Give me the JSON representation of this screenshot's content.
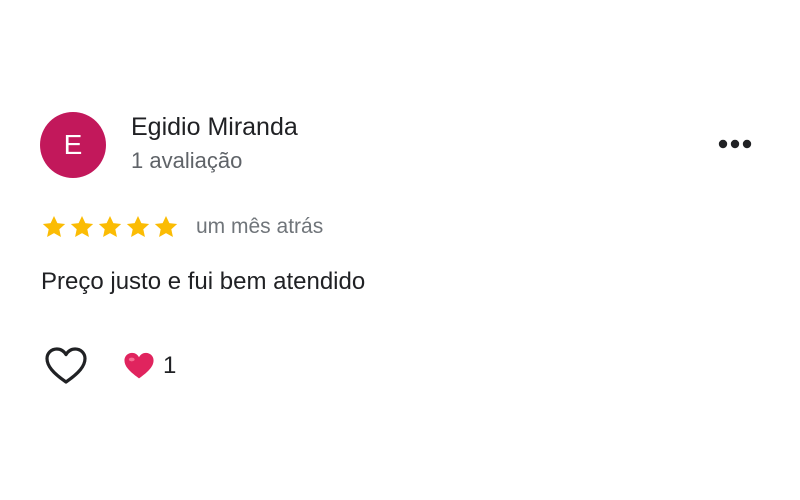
{
  "review": {
    "author": {
      "initial": "E",
      "name": "Egidio Miranda",
      "review_count": "1 avaliação",
      "avatar_color": "#c2185b"
    },
    "rating": 5,
    "rating_max": 5,
    "star_color": "#fbbc04",
    "date": "um mês atrás",
    "text": "Preço justo e fui bem atendido",
    "reactions": {
      "like_icon": "heart-outline-icon",
      "reaction_icon": "red-heart-icon",
      "reaction_color": "#e0245e",
      "count": "1"
    },
    "menu_icon": "more-horizontal-icon"
  }
}
